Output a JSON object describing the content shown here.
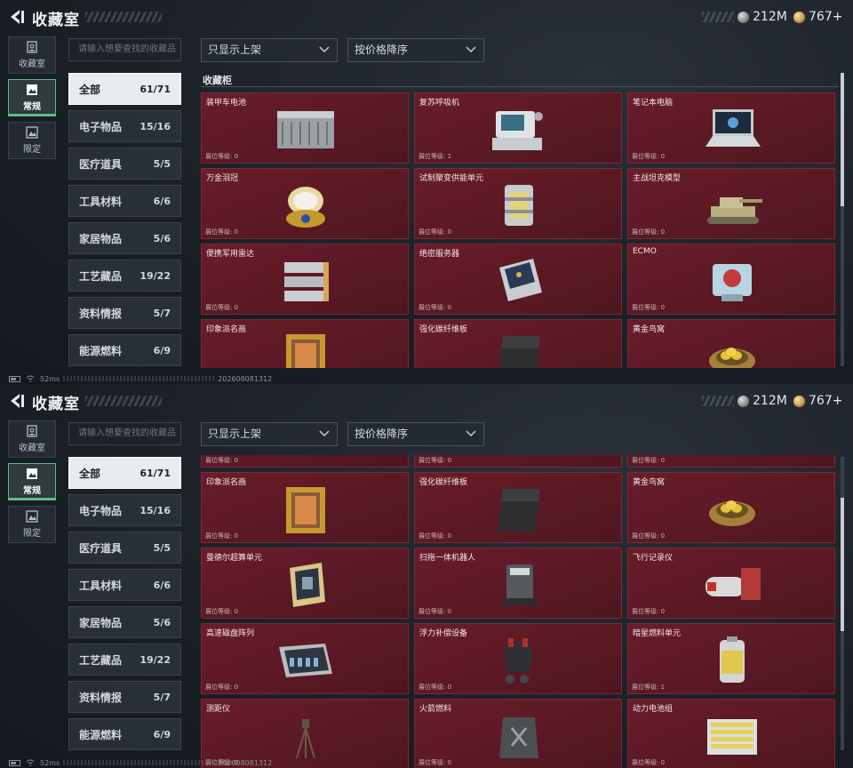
{
  "app": {
    "title": "收藏室",
    "currency": [
      {
        "icon": "silver-coin-icon",
        "value": "212M"
      },
      {
        "icon": "gold-coin-icon",
        "value": "767+"
      }
    ]
  },
  "left_nav": [
    {
      "label": "收藏室",
      "icon": "collection-icon",
      "active": false
    },
    {
      "label": "常规",
      "icon": "regular-icon",
      "active": true
    },
    {
      "label": "限定",
      "icon": "limited-icon",
      "active": false
    }
  ],
  "search": {
    "placeholder": "请输入想要查找的收藏品"
  },
  "filters": {
    "display": "只显示上架",
    "sort": "按价格降序"
  },
  "categories": [
    {
      "name": "全部",
      "count": "61/71",
      "active": true
    },
    {
      "name": "电子物品",
      "count": "15/16",
      "active": false
    },
    {
      "name": "医疗道具",
      "count": "5/5",
      "active": false
    },
    {
      "name": "工具材料",
      "count": "6/6",
      "active": false
    },
    {
      "name": "家居物品",
      "count": "5/6",
      "active": false
    },
    {
      "name": "工艺藏品",
      "count": "19/22",
      "active": false
    },
    {
      "name": "资料情报",
      "count": "5/7",
      "active": false
    },
    {
      "name": "能源燃料",
      "count": "6/9",
      "active": false
    }
  ],
  "section_label": "收藏柜",
  "level_label": "展位等级",
  "items_view1": [
    {
      "name": "装甲车电池",
      "level": "0",
      "icon": "armored-battery-icon"
    },
    {
      "name": "复苏呼吸机",
      "level": "1",
      "icon": "ventilator-icon"
    },
    {
      "name": "笔记本电脑",
      "level": "0",
      "icon": "laptop-icon"
    },
    {
      "name": "万金泪冠",
      "level": "0",
      "icon": "jeweled-egg-icon"
    },
    {
      "name": "试制聚变供能单元",
      "level": "0",
      "icon": "fusion-unit-icon"
    },
    {
      "name": "主战坦克模型",
      "level": "0",
      "icon": "tank-model-icon"
    },
    {
      "name": "便携军用雷达",
      "level": "0",
      "icon": "radar-icon"
    },
    {
      "name": "绝密服务器",
      "level": "0",
      "icon": "server-icon"
    },
    {
      "name": "ECMO",
      "level": "0",
      "icon": "ecmo-icon"
    },
    {
      "name": "印象派名画",
      "level": "0",
      "icon": "painting-icon"
    },
    {
      "name": "强化碳纤维板",
      "level": "0",
      "icon": "carbon-plate-icon"
    },
    {
      "name": "黄金鸟窝",
      "level": "0",
      "icon": "golden-nest-icon"
    }
  ],
  "items_view2": [
    {
      "name": "",
      "level": "0",
      "icon": ""
    },
    {
      "name": "",
      "level": "0",
      "icon": ""
    },
    {
      "name": "",
      "level": "0",
      "icon": ""
    },
    {
      "name": "印象派名画",
      "level": "0",
      "icon": "painting-icon"
    },
    {
      "name": "强化碳纤维板",
      "level": "0",
      "icon": "carbon-plate-icon"
    },
    {
      "name": "黄金鸟窝",
      "level": "0",
      "icon": "golden-nest-icon"
    },
    {
      "name": "曼德尔超算单元",
      "level": "0",
      "icon": "supercomputer-unit-icon"
    },
    {
      "name": "扫拖一体机器人",
      "level": "0",
      "icon": "robot-vacuum-icon"
    },
    {
      "name": "飞行记录仪",
      "level": "0",
      "icon": "flight-recorder-icon"
    },
    {
      "name": "高速磁盘阵列",
      "level": "0",
      "icon": "disk-array-icon"
    },
    {
      "name": "浮力补偿设备",
      "level": "0",
      "icon": "buoyancy-device-icon"
    },
    {
      "name": "暗星燃料单元",
      "level": "1",
      "icon": "fuel-canister-icon"
    },
    {
      "name": "测距仪",
      "level": "0",
      "icon": "rangefinder-icon"
    },
    {
      "name": "火箭燃料",
      "level": "0",
      "icon": "rocket-fuel-icon"
    },
    {
      "name": "动力电池组",
      "level": "0",
      "icon": "battery-pack-icon"
    }
  ],
  "status": {
    "ping": "52ms",
    "id": "202608081312"
  },
  "colors": {
    "card": "#5e1a26",
    "accent": "#56c08c",
    "active_category": "#e9ecee"
  }
}
